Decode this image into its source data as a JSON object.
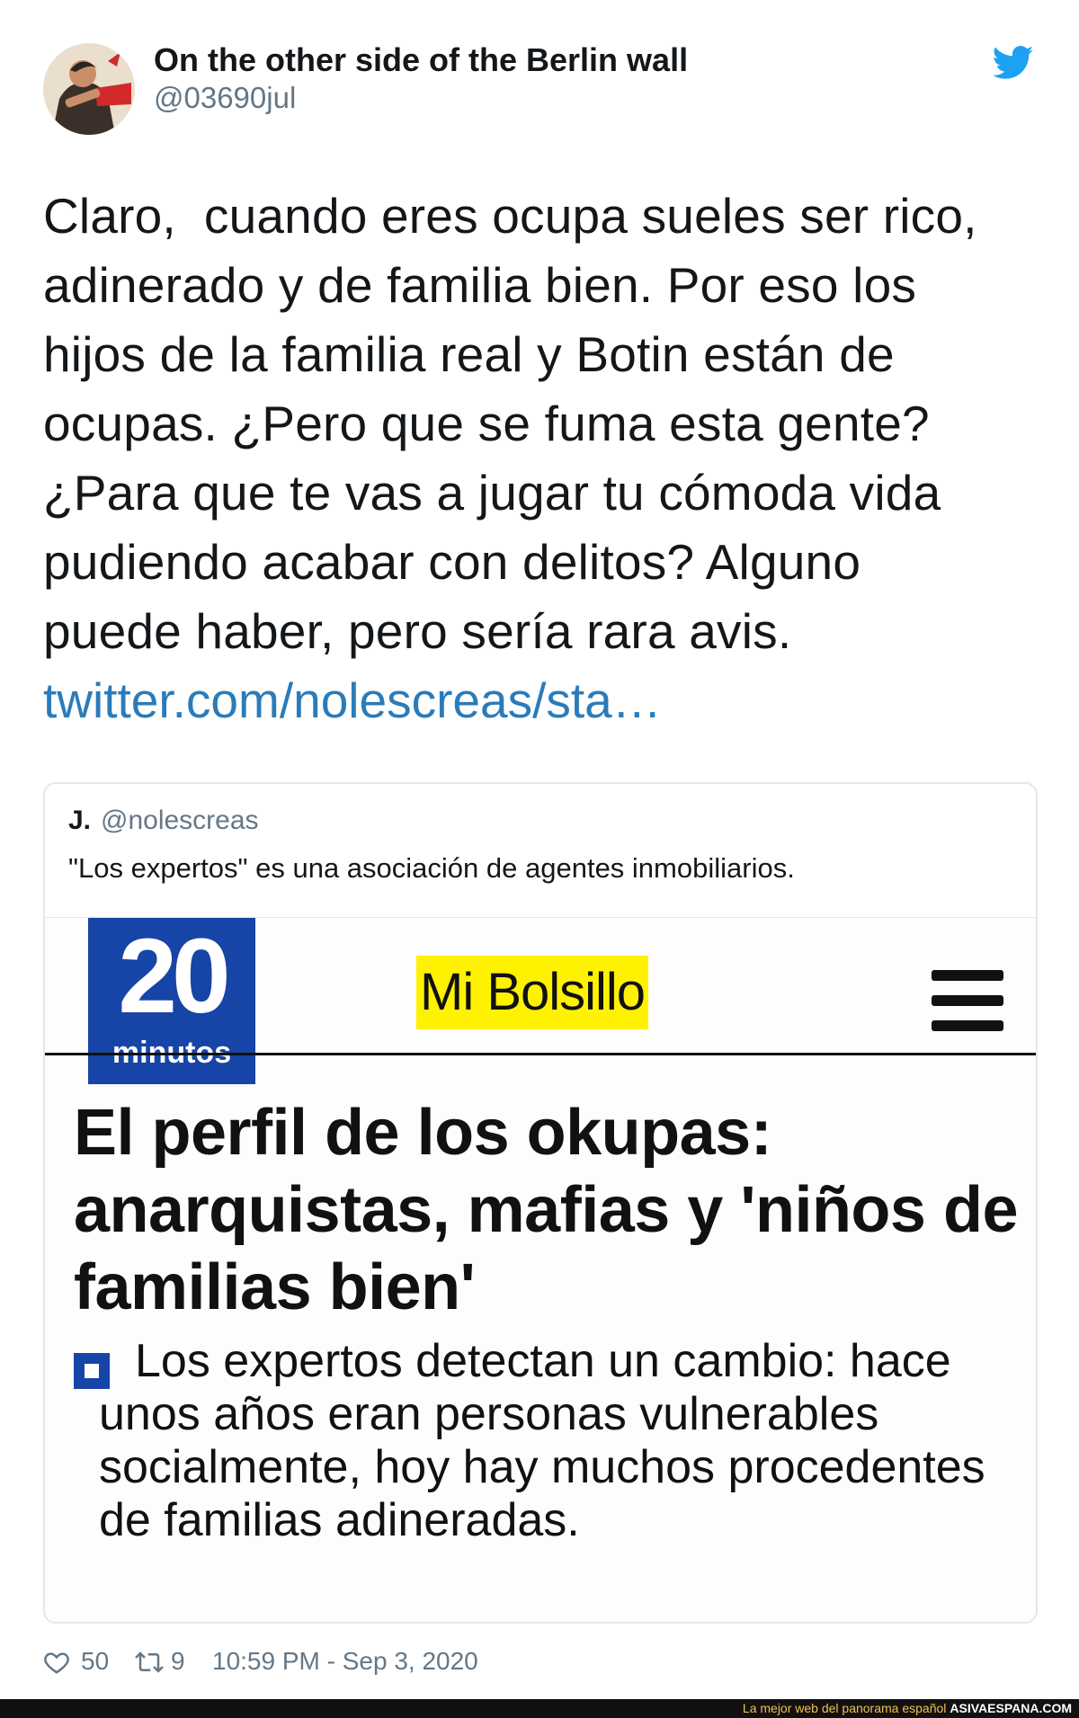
{
  "author": {
    "display_name": "On the other side of the Berlin wall",
    "handle": "@03690jul"
  },
  "tweet": {
    "text": "Claro,  cuando eres ocupa sueles ser rico,\nadinerado y de familia bien. Por eso los\nhijos de la familia real y Botin están de\nocupas. ¿Pero que se fuma esta gente?\n¿Para que te vas a jugar tu cómoda vida\npudiendo acabar con delitos? Alguno\npuede haber, pero sería rara avis.",
    "link": "twitter.com/nolescreas/sta…"
  },
  "quoted": {
    "name": "J.",
    "handle": "@nolescreas",
    "text": "\"Los expertos\" es una asociación de agentes inmobiliarios.",
    "image": {
      "logo_number": "20",
      "logo_word": "minutos",
      "section": "Mi Bolsillo",
      "headline": "El perfil de los okupas: anarquistas, mafias y 'niños de familias bien'",
      "subhead": "Los expertos detectan un cambio: hace unos años eran personas vulnerables socialmente, hoy hay muchos procedentes de familias adineradas."
    }
  },
  "meta": {
    "likes": "50",
    "retweets": "9",
    "timestamp": "10:59 PM - Sep 3, 2020"
  },
  "footer": {
    "tagline": "La mejor web del panorama español",
    "brand": "ASIVAESPANA.COM"
  },
  "icons": [
    "avatar",
    "twitter-bird-icon",
    "menu-icon",
    "heart-icon",
    "retweet-icon"
  ],
  "colors": {
    "twitter_blue": "#1da1f2",
    "link": "#2b7bb9",
    "brand_blue": "#1744a7",
    "highlight": "#fff200"
  }
}
